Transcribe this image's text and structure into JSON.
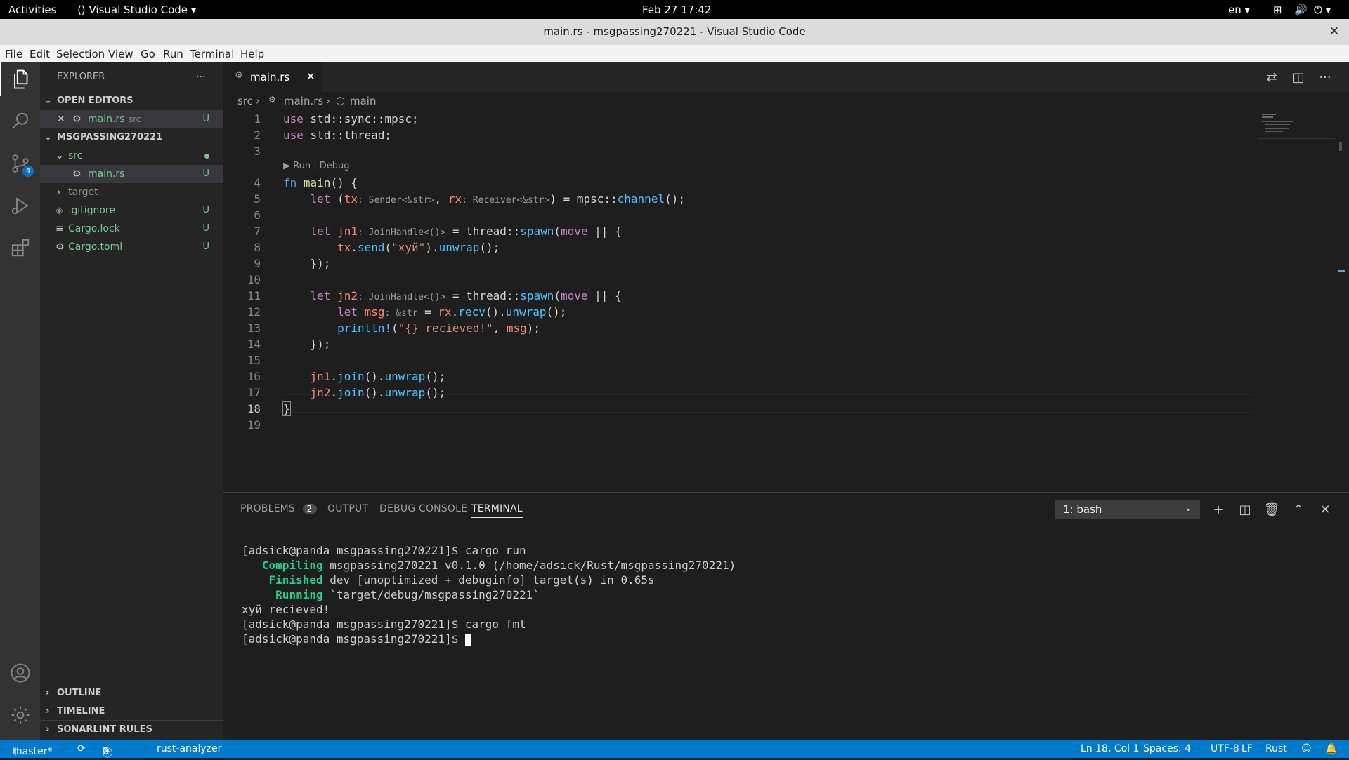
{
  "topbar": {
    "activities": "Activities",
    "app": "Visual Studio Code",
    "datetime": "Feb 27  17:42",
    "lang": "en"
  },
  "window": {
    "title": "main.rs - msgpassing270221 - Visual Studio Code"
  },
  "menu": [
    "File",
    "Edit",
    "Selection",
    "View",
    "Go",
    "Run",
    "Terminal",
    "Help"
  ],
  "activity": {
    "scm_badge": "4"
  },
  "sidebar": {
    "header": "EXPLORER",
    "open_editors": "OPEN EDITORS",
    "open_file": "main.rs",
    "open_file_dir": "src",
    "open_file_status": "U",
    "project": "MSGPASSING270221",
    "tree": [
      {
        "label": "src",
        "status": "",
        "depth": 1
      },
      {
        "label": "main.rs",
        "status": "U",
        "depth": 2
      },
      {
        "label": "target",
        "status": "",
        "depth": 1
      },
      {
        "label": ".gitignore",
        "status": "U",
        "depth": 1
      },
      {
        "label": "Cargo.lock",
        "status": "U",
        "depth": 1
      },
      {
        "label": "Cargo.toml",
        "status": "U",
        "depth": 1
      }
    ],
    "outline": "OUTLINE",
    "timeline": "TIMELINE",
    "sonarlint": "SONARLINT RULES"
  },
  "editor": {
    "tab": "main.rs",
    "breadcrumb": [
      "src",
      "main.rs",
      "main"
    ],
    "codelens": "▶ Run | Debug",
    "line_numbers": [
      "1",
      "2",
      "3",
      "4",
      "5",
      "6",
      "7",
      "8",
      "9",
      "10",
      "11",
      "12",
      "13",
      "14",
      "15",
      "16",
      "17",
      "18",
      "19"
    ]
  },
  "panel": {
    "tabs": [
      "PROBLEMS",
      "OUTPUT",
      "DEBUG CONSOLE",
      "TERMINAL"
    ],
    "problems_count": "2",
    "terminal_select": "1: bash",
    "terminal_lines": [
      "[adsick@panda msgpassing270221]$ cargo run",
      "msgpassing270221 v0.1.0 (/home/adsick/Rust/msgpassing270221)",
      "dev [unoptimized + debuginfo] target(s) in 0.65s",
      "`target/debug/msgpassing270221`",
      "хуй recieved!",
      "[adsick@panda msgpassing270221]$ cargo fmt",
      "[adsick@panda msgpassing270221]$ "
    ],
    "compiling": "Compiling",
    "finished": "Finished",
    "running": "Running"
  },
  "status": {
    "branch": "master*",
    "errors": "2",
    "warnings": "0",
    "analyzer": "rust-analyzer",
    "position": "Ln 18, Col 1",
    "spaces": "Spaces: 4",
    "encoding": "UTF-8",
    "eol": "LF",
    "language": "Rust"
  }
}
